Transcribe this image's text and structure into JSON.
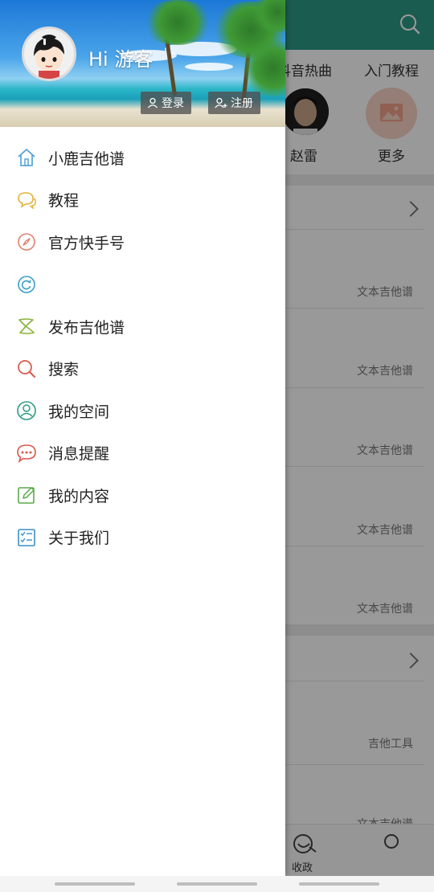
{
  "background_app": {
    "grid": {
      "row1": [
        "抖音热曲",
        "入门教程"
      ],
      "row2": [
        "赵雷",
        "更多"
      ]
    },
    "tags": [
      "文本吉他谱",
      "文本吉他谱",
      "文本吉他谱",
      "文本吉他谱",
      "文本吉他谱",
      "吉他工具",
      "文本吉他谱"
    ],
    "bottom_nav": [
      "收政"
    ]
  },
  "drawer": {
    "greeting": "Hi 游客",
    "login_label": "登录",
    "register_label": "注册",
    "menu": [
      {
        "label": "小鹿吉他谱",
        "icon": "home-icon",
        "color": "#4a9fd8"
      },
      {
        "label": "教程",
        "icon": "chat-bubble-icon",
        "color": "#e2b23a"
      },
      {
        "label": "官方快手号",
        "icon": "compass-icon",
        "color": "#e07f6e"
      },
      {
        "label": "",
        "icon": "refresh-icon",
        "color": "#3a9fc8"
      },
      {
        "label": "发布吉他谱",
        "icon": "publish-icon",
        "color": "#8bb23a"
      },
      {
        "label": "搜索",
        "icon": "search-icon",
        "color": "#d9564a"
      },
      {
        "label": "我的空间",
        "icon": "user-icon",
        "color": "#2f9a86"
      },
      {
        "label": "消息提醒",
        "icon": "message-icon",
        "color": "#d9564a"
      },
      {
        "label": "我的内容",
        "icon": "edit-icon",
        "color": "#5aab4a"
      },
      {
        "label": "关于我们",
        "icon": "checklist-icon",
        "color": "#3a8fc8"
      }
    ]
  },
  "colors": {
    "topbar": "#2e9a86",
    "drawer_bg": "#ffffff",
    "overlay": "rgba(0,0,0,0.40)"
  }
}
